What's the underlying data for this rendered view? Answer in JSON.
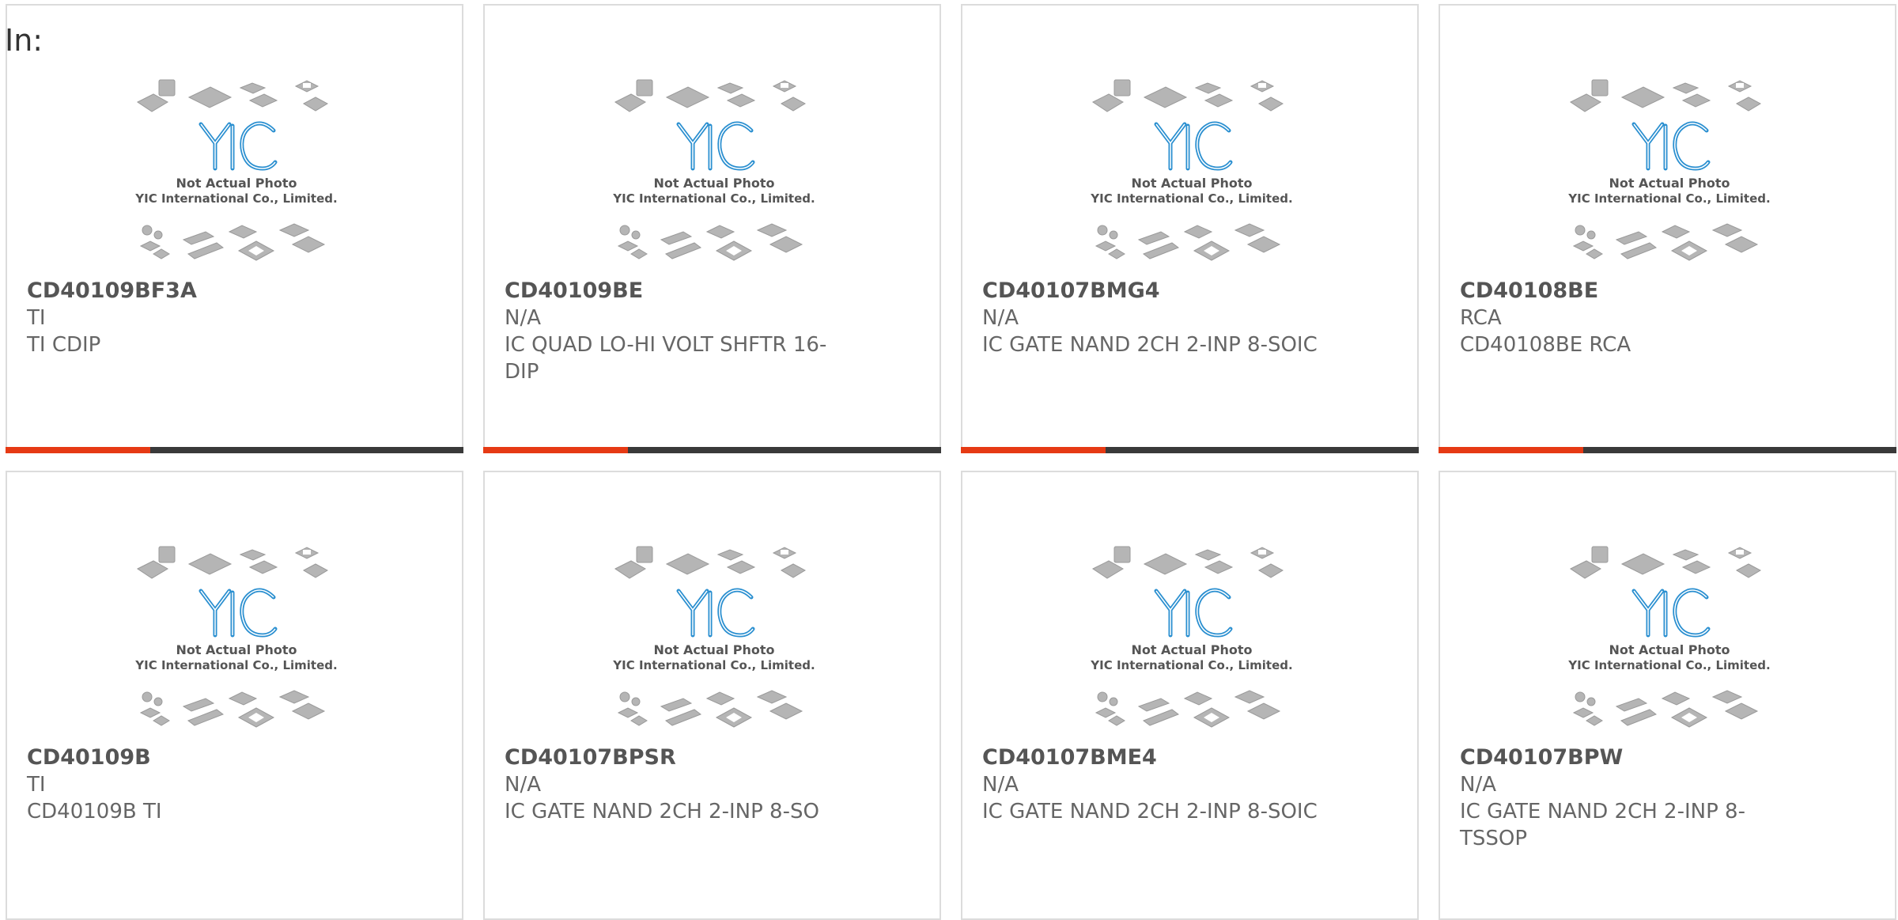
{
  "page": {
    "label": "In:"
  },
  "colors": {
    "accent": "#e63a14",
    "bar_dark": "#3a3a3a",
    "logo_blue": "#2a8fd0"
  },
  "placeholder_image": {
    "logo_text": "YIC",
    "line1": "Not Actual Photo",
    "line2": "YIC International Co., Limited."
  },
  "products": [
    {
      "part_number": "CD40109BF3A",
      "manufacturer": "TI",
      "description": "TI CDIP",
      "bar_visible": true
    },
    {
      "part_number": "CD40109BE",
      "manufacturer": "N/A",
      "description": "IC QUAD LO-HI VOLT SHFTR 16-DIP",
      "bar_visible": true
    },
    {
      "part_number": "CD40107BMG4",
      "manufacturer": "N/A",
      "description": "IC GATE NAND 2CH 2-INP 8-SOIC",
      "bar_visible": true
    },
    {
      "part_number": "CD40108BE",
      "manufacturer": "RCA",
      "description": "CD40108BE RCA",
      "bar_visible": true
    },
    {
      "part_number": "CD40109B",
      "manufacturer": "TI",
      "description": "CD40109B TI",
      "bar_visible": false
    },
    {
      "part_number": "CD40107BPSR",
      "manufacturer": "N/A",
      "description": "IC GATE NAND 2CH 2-INP 8-SO",
      "bar_visible": false
    },
    {
      "part_number": "CD40107BME4",
      "manufacturer": "N/A",
      "description": "IC GATE NAND 2CH 2-INP 8-SOIC",
      "bar_visible": false
    },
    {
      "part_number": "CD40107BPW",
      "manufacturer": "N/A",
      "description": "IC GATE NAND 2CH 2-INP 8-TSSOP",
      "bar_visible": false
    }
  ]
}
